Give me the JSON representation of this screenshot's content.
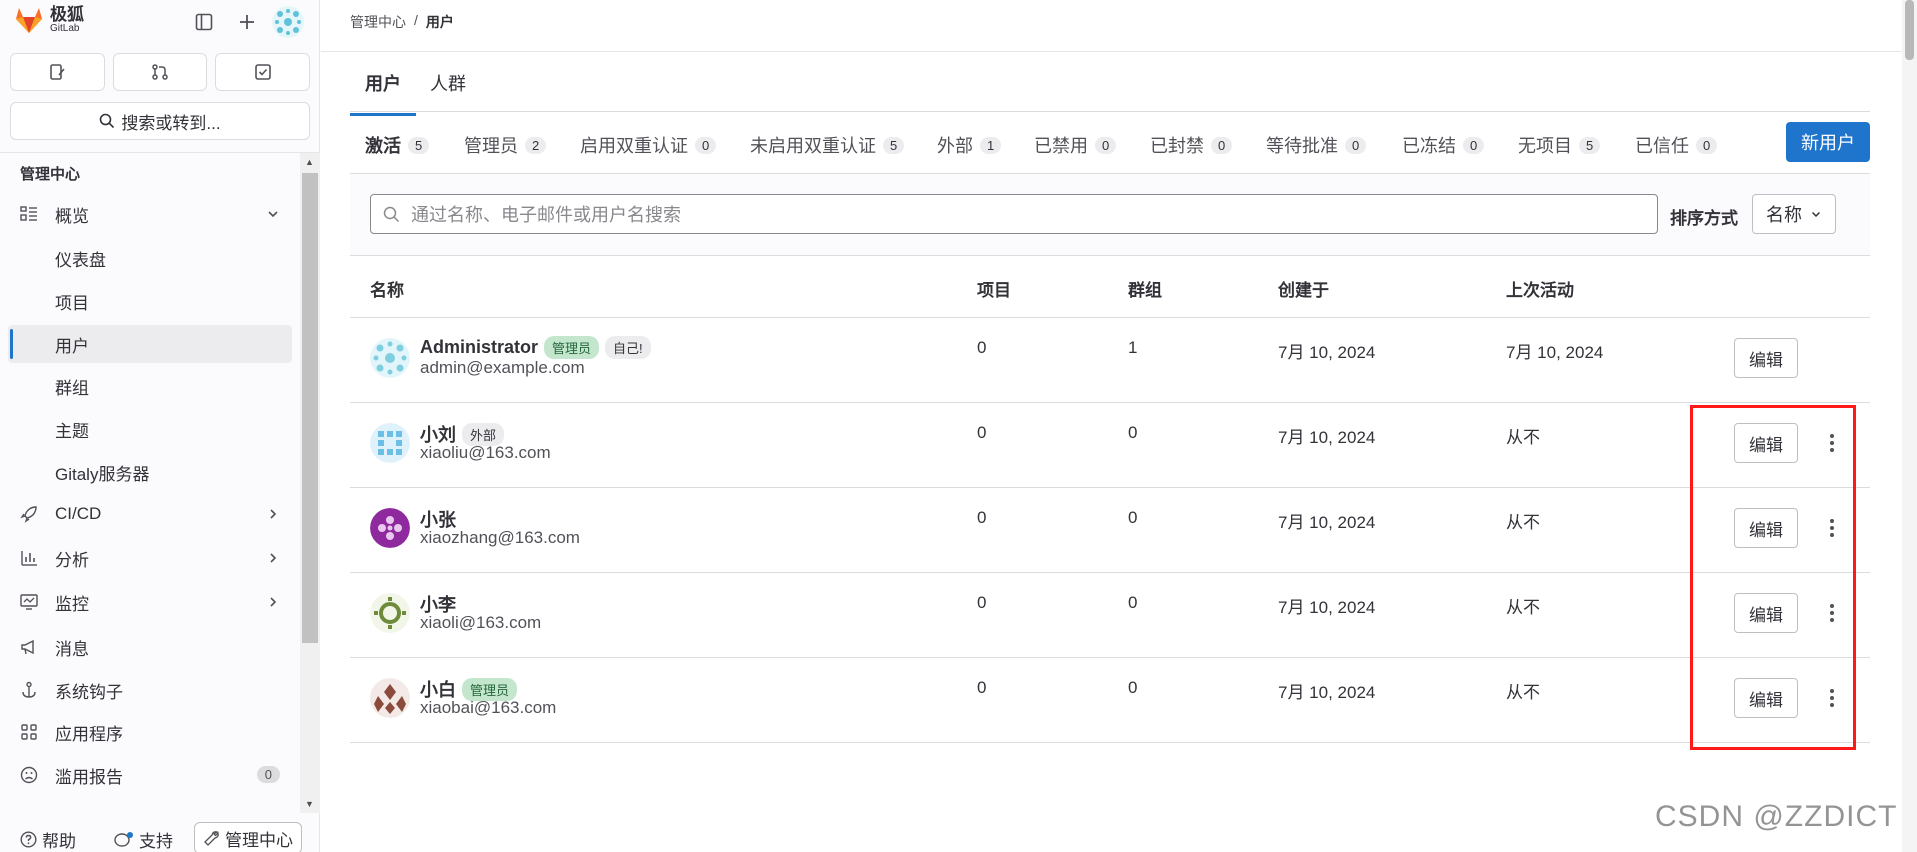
{
  "app": {
    "name": "极狐",
    "sub": "GitLab"
  },
  "sidebar": {
    "search_label": "搜索或转到...",
    "section_title": "管理中心",
    "items": [
      {
        "label": "概览",
        "icon": "overview-icon"
      },
      {
        "label": "仪表盘"
      },
      {
        "label": "项目"
      },
      {
        "label": "用户"
      },
      {
        "label": "群组"
      },
      {
        "label": "主题"
      },
      {
        "label": "Gitaly服务器"
      },
      {
        "label": "CI/CD",
        "icon": "rocket-icon"
      },
      {
        "label": "分析",
        "icon": "chart-icon"
      },
      {
        "label": "监控",
        "icon": "monitor-icon"
      },
      {
        "label": "消息",
        "icon": "bullhorn-icon"
      },
      {
        "label": "系统钩子",
        "icon": "anchor-icon"
      },
      {
        "label": "应用程序",
        "icon": "apps-icon"
      },
      {
        "label": "滥用报告",
        "icon": "abuse-icon",
        "badge": "0"
      }
    ],
    "bottom": {
      "help": "帮助",
      "support": "支持",
      "admin": "管理中心"
    }
  },
  "breadcrumb": {
    "root": "管理中心",
    "sep": "/",
    "current": "用户"
  },
  "tabs_top": [
    "用户",
    "人群"
  ],
  "tabs_filter": [
    {
      "label": "激活",
      "count": "5"
    },
    {
      "label": "管理员",
      "count": "2"
    },
    {
      "label": "启用双重认证",
      "count": "0"
    },
    {
      "label": "未启用双重认证",
      "count": "5"
    },
    {
      "label": "外部",
      "count": "1"
    },
    {
      "label": "已禁用",
      "count": "0"
    },
    {
      "label": "已封禁",
      "count": "0"
    },
    {
      "label": "等待批准",
      "count": "0"
    },
    {
      "label": "已冻结",
      "count": "0"
    },
    {
      "label": "无项目",
      "count": "5"
    },
    {
      "label": "已信任",
      "count": "0"
    }
  ],
  "new_user_label": "新用户",
  "search": {
    "placeholder": "通过名称、电子邮件或用户名搜索"
  },
  "sort": {
    "label": "排序方式",
    "value": "名称"
  },
  "table": {
    "headers": [
      "名称",
      "项目",
      "群组",
      "创建于",
      "上次活动"
    ],
    "edit_label": "编辑",
    "rows": [
      {
        "name": "Administrator",
        "badges": [
          "管理员",
          "自己!"
        ],
        "email": "admin@example.com",
        "projects": "0",
        "groups": "1",
        "created": "7月 10, 2024",
        "last": "7月 10, 2024"
      },
      {
        "name": "小刘",
        "badges": [
          "外部"
        ],
        "email": "xiaoliu@163.com",
        "projects": "0",
        "groups": "0",
        "created": "7月 10, 2024",
        "last": "从不"
      },
      {
        "name": "小张",
        "badges": [],
        "email": "xiaozhang@163.com",
        "projects": "0",
        "groups": "0",
        "created": "7月 10, 2024",
        "last": "从不"
      },
      {
        "name": "小李",
        "badges": [],
        "email": "xiaoli@163.com",
        "projects": "0",
        "groups": "0",
        "created": "7月 10, 2024",
        "last": "从不"
      },
      {
        "name": "小白",
        "badges": [
          "管理员"
        ],
        "email": "xiaobai@163.com",
        "projects": "0",
        "groups": "0",
        "created": "7月 10, 2024",
        "last": "从不"
      }
    ]
  },
  "watermark": "CSDN @ZZDICT",
  "colors": {
    "accent": "#1f75cb",
    "highlight": "#ff1a1a"
  }
}
